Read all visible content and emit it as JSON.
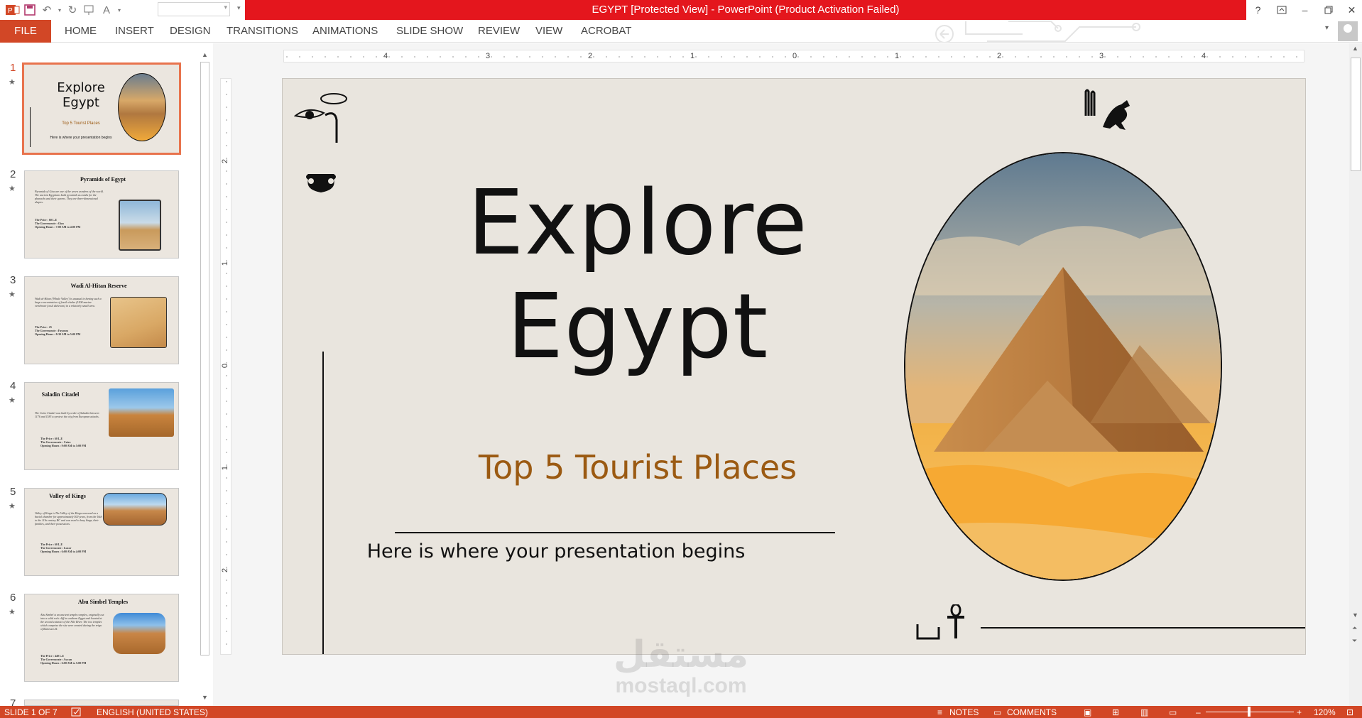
{
  "window": {
    "title": "EGYPT [Protected View] -  PowerPoint (Product Activation Failed)",
    "help_label": "?"
  },
  "ribbon": {
    "tabs": [
      "FILE",
      "HOME",
      "INSERT",
      "DESIGN",
      "TRANSITIONS",
      "ANIMATIONS",
      "SLIDE SHOW",
      "REVIEW",
      "VIEW",
      "ACROBAT"
    ]
  },
  "thumbnails": [
    {
      "number": "1",
      "title_line1": "Explore",
      "title_line2": "Egypt",
      "subtitle": "Top 5 Tourist Places",
      "tagline": "Here is where your presentation begins"
    },
    {
      "number": "2",
      "title": "Pyramids of Egypt",
      "text": "Pyramids of Giza are one of the seven wonders of the world. The ancient Egyptians built pyramids as tombs for the pharaohs and their queens. They are three-dimensional shapes.",
      "bullets": [
        "The Price : 60 L.E",
        "The Governorate : Giza",
        "Opening Hours : 7:00 AM to 4:00 PM"
      ]
    },
    {
      "number": "3",
      "title": "Wadi Al-Hitan Reserve",
      "text": "Wadi al-Hitan ('Whale Valley') is unusual in having such a large concentration of fossil whales (1500 marine vertebrate fossil skeletons) in a relatively small area.",
      "bullets": [
        "The Price : 25",
        "The Governorate : Fayoum",
        "Opening Hours : 8:30 AM to 5:00 PM"
      ]
    },
    {
      "number": "4",
      "title": "Saladin Citadel",
      "text": "The Cairo Citadel was built by order of Saladin between 1176 and 1183 to protect the city from European attacks.",
      "bullets": [
        "The Price : 60 L.E",
        "The Governorate : Cairo",
        "Opening Hours : 9:00 AM to 5:00 PM"
      ]
    },
    {
      "number": "5",
      "title": "Valley of Kings",
      "text": "Valley of Kings is The Valley of the Kings was used as a burial chamber for approximately 500 years, from the 16th to the 11th century BC and was used to bury kings, their families, and their possessions.",
      "bullets": [
        "The Price : 60 L.E",
        "The Governorate : Luxor",
        "Opening Hours : 6:00 AM to 4:00 PM"
      ]
    },
    {
      "number": "6",
      "title": "Abu Simbel Temples",
      "text": "Abu Simbel is an ancient temple complex, originally cut into a solid rock cliff in southern Egypt and located at the second cataract of the Nile River. The two temples which comprise the site were created during the reign of Ramesses II.",
      "bullets": [
        "The Price : 440 L.E",
        "The Governorate : Aswan",
        "Opening Hours : 6:00 AM to 5:00 PM"
      ]
    },
    {
      "number": "7"
    }
  ],
  "slide": {
    "title_line1": "Explore",
    "title_line2": "Egypt",
    "subtitle": "Top 5 Tourist Places",
    "tagline": "Here is where your presentation begins"
  },
  "ruler": {
    "h_labels": [
      "4",
      "3",
      "2",
      "1",
      "0",
      "1",
      "2",
      "3",
      "4"
    ],
    "v_labels": [
      "2",
      "1",
      "0",
      "1",
      "2"
    ]
  },
  "status": {
    "slide_info": "SLIDE 1 OF 7",
    "language": "ENGLISH (UNITED STATES)",
    "notes": "NOTES",
    "comments": "COMMENTS",
    "zoom": "120%"
  },
  "watermark": {
    "arabic": "مستقل",
    "latin": "mostaql.com"
  },
  "colors": {
    "title_bar": "#e4161d",
    "accent": "#d24726",
    "slide_bg": "#e9e5de",
    "subtitle": "#9b5a12"
  }
}
